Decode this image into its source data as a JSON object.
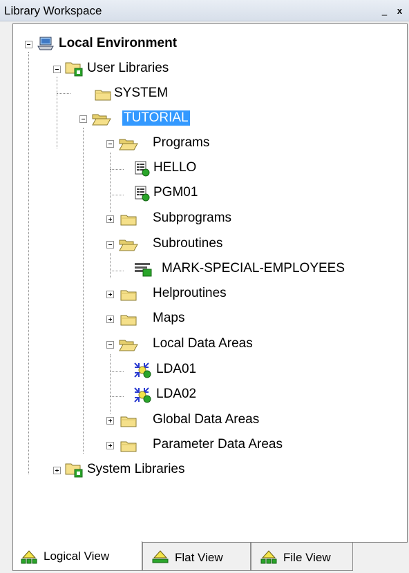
{
  "window": {
    "title": "Library Workspace",
    "minimize": "_",
    "close": "x"
  },
  "tree": {
    "root": "Local Environment",
    "user_libraries": "User Libraries",
    "system": "SYSTEM",
    "tutorial": "TUTORIAL",
    "programs": "Programs",
    "hello": "HELLO",
    "pgm01": "PGM01",
    "subprograms": "Subprograms",
    "subroutines": "Subroutines",
    "mark_special": "MARK-SPECIAL-EMPLOYEES",
    "helproutines": "Helproutines",
    "maps": "Maps",
    "lda": "Local Data Areas",
    "lda01": "LDA01",
    "lda02": "LDA02",
    "gda": "Global Data Areas",
    "pda": "Parameter Data Areas",
    "system_libraries": "System Libraries"
  },
  "tabs": {
    "logical": "Logical View",
    "flat": "Flat View",
    "file": "File View",
    "active": "logical"
  },
  "colors": {
    "selection": "#3399ff",
    "folder": "#f5e08a",
    "folder_edge": "#8a7a2e",
    "status_green": "#2aa52a"
  }
}
